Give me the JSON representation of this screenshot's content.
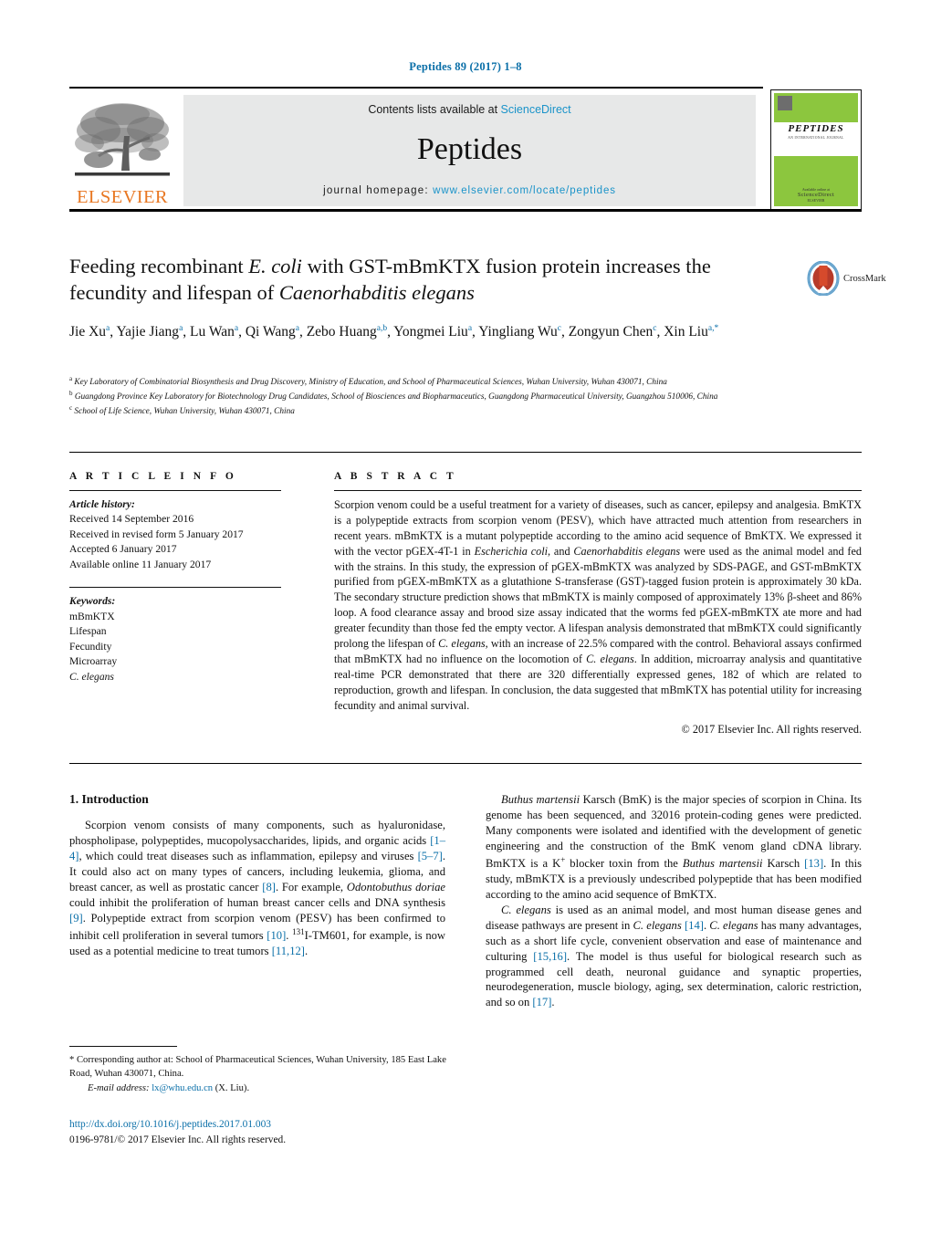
{
  "running_head": "Peptides 89 (2017) 1–8",
  "masthead": {
    "contents_prefix": "Contents lists available at ",
    "contents_link": "ScienceDirect",
    "journal_name": "Peptides",
    "homepage_prefix": "journal homepage: ",
    "homepage_url": "www.elsevier.com/locate/peptides",
    "publisher_logo_text": "ELSEVIER",
    "cover": {
      "title": "PEPTIDES",
      "subtitle": "AN INTERNATIONAL JOURNAL",
      "publisher": "ELSEVIER",
      "available_at": "Available online at",
      "science_direct": "ScienceDirect"
    }
  },
  "article": {
    "title_line1_a": "Feeding recombinant ",
    "title_line1_i": "E. coli",
    "title_line1_b": " with GST-mBmKTX fusion protein",
    "title_line2_a": "increases the fecundity and lifespan of ",
    "title_line2_i": "Caenorhabditis elegans",
    "crossmark_label": "CrossMark",
    "authors": [
      {
        "name": "Jie Xu",
        "sup": "a"
      },
      {
        "name": "Yajie Jiang",
        "sup": "a"
      },
      {
        "name": "Lu Wan",
        "sup": "a"
      },
      {
        "name": "Qi Wang",
        "sup": "a"
      },
      {
        "name": "Zebo Huang",
        "sup": "a,b"
      },
      {
        "name": "Yongmei Liu",
        "sup": "a"
      },
      {
        "name": "Yingliang Wu",
        "sup": "c"
      },
      {
        "name": "Zongyun Chen",
        "sup": "c"
      },
      {
        "name": "Xin Liu",
        "sup": "a,*"
      }
    ],
    "affiliations": [
      {
        "marker": "a",
        "text": "Key Laboratory of Combinatorial Biosynthesis and Drug Discovery, Ministry of Education, and School of Pharmaceutical Sciences, Wuhan University, Wuhan 430071, China"
      },
      {
        "marker": "b",
        "text": "Guangdong Province Key Laboratory for Biotechnology Drug Candidates, School of Biosciences and Biopharmaceutics, Guangdong Pharmaceutical University, Guangzhou 510006, China"
      },
      {
        "marker": "c",
        "text": "School of Life Science, Wuhan University, Wuhan 430071, China"
      }
    ]
  },
  "article_info": {
    "heading": "A R T I C L E   I N F O",
    "history_label": "Article history:",
    "history": [
      "Received 14 September 2016",
      "Received in revised form 5 January 2017",
      "Accepted 6 January 2017",
      "Available online 11 January 2017"
    ],
    "keywords_label": "Keywords:",
    "keywords": [
      "mBmKTX",
      "Lifespan",
      "Fecundity",
      "Microarray",
      "C. elegans"
    ]
  },
  "abstract": {
    "heading": "A B S T R A C T",
    "text_parts": [
      {
        "t": "Scorpion venom could be a useful treatment for a variety of diseases, such as cancer, epilepsy and analgesia. BmKTX is a polypeptide extracts from scorpion venom (PESV), which have attracted much attention from researchers in recent years. mBmKTX is a mutant polypeptide according to the amino acid sequence of BmKTX. We expressed it with the vector pGEX-4T-1 in ",
        "i": false
      },
      {
        "t": "Escherichia coli",
        "i": true
      },
      {
        "t": ", and ",
        "i": false
      },
      {
        "t": "Caenorhabditis elegans",
        "i": true
      },
      {
        "t": " were used as the animal model and fed with the strains. In this study, the expression of pGEX-mBmKTX was analyzed by SDS-PAGE, and GST-mBmKTX purified from pGEX-mBmKTX as a glutathione S-transferase (GST)-tagged fusion protein is approximately 30 kDa. The secondary structure prediction shows that mBmKTX is mainly composed of approximately 13% β-sheet and 86% loop. A food clearance assay and brood size assay indicated that the worms fed pGEX-mBmKTX ate more and had greater fecundity than those fed the empty vector. A lifespan analysis demonstrated that mBmKTX could significantly prolong the lifespan of ",
        "i": false
      },
      {
        "t": "C. elegans",
        "i": true
      },
      {
        "t": ", with an increase of 22.5% compared with the control. Behavioral assays confirmed that mBmKTX had no influence on the locomotion of ",
        "i": false
      },
      {
        "t": "C. elegans",
        "i": true
      },
      {
        "t": ". In addition, microarray analysis and quantitative real-time PCR demonstrated that there are 320 differentially expressed genes, 182 of which are related to reproduction, growth and lifespan. In conclusion, the data suggested that mBmKTX has potential utility for increasing fecundity and animal survival.",
        "i": false
      }
    ],
    "copyright": "© 2017 Elsevier Inc. All rights reserved."
  },
  "introduction": {
    "heading": "1. Introduction",
    "left_paragraph": [
      {
        "t": "Scorpion venom consists of many components, such as hyaluronidase, phospholipase, polypeptides, mucopolysaccharides, lipids, and organic acids ",
        "k": "n"
      },
      {
        "t": "[1–4]",
        "k": "ref"
      },
      {
        "t": ", which could treat diseases such as inflammation, epilepsy and viruses ",
        "k": "n"
      },
      {
        "t": "[5–7]",
        "k": "ref"
      },
      {
        "t": ". It could also act on many types of cancers, including leukemia, glioma, and breast cancer, as well as prostatic cancer ",
        "k": "n"
      },
      {
        "t": "[8]",
        "k": "ref"
      },
      {
        "t": ". For example, ",
        "k": "n"
      },
      {
        "t": "Odontobuthus doriae",
        "k": "i"
      },
      {
        "t": " could inhibit the proliferation of human breast cancer cells and DNA synthesis ",
        "k": "n"
      },
      {
        "t": "[9]",
        "k": "ref"
      },
      {
        "t": ". Polypeptide extract from scorpion venom (PESV) has been confirmed to inhibit cell proliferation in several tumors ",
        "k": "n"
      },
      {
        "t": "[10]",
        "k": "ref"
      },
      {
        "t": ". ",
        "k": "n"
      },
      {
        "t": "131",
        "k": "sup"
      },
      {
        "t": "I-TM601, for example, is now used as a potential medicine to treat tumors ",
        "k": "n"
      },
      {
        "t": "[11,12]",
        "k": "ref"
      },
      {
        "t": ".",
        "k": "n"
      }
    ],
    "right_paragraph_1": [
      {
        "t": "Buthus martensii",
        "k": "i"
      },
      {
        "t": " Karsch (BmK) is the major species of scorpion in China. Its genome has been sequenced, and 32016 protein-coding genes were predicted. Many components were isolated and identified with the development of genetic engineering and the construction of the BmK venom gland cDNA library. BmKTX is a K",
        "k": "n"
      },
      {
        "t": "+",
        "k": "sup"
      },
      {
        "t": " blocker toxin from the ",
        "k": "n"
      },
      {
        "t": "Buthus martensii",
        "k": "i"
      },
      {
        "t": " Karsch ",
        "k": "n"
      },
      {
        "t": "[13]",
        "k": "ref"
      },
      {
        "t": ". In this study, mBmKTX is a previously undescribed polypeptide that has been modified according to the amino acid sequence of BmKTX.",
        "k": "n"
      }
    ],
    "right_paragraph_2": [
      {
        "t": "C. elegans",
        "k": "i"
      },
      {
        "t": " is used as an animal model, and most human disease genes and disease pathways are present in ",
        "k": "n"
      },
      {
        "t": "C. elegans",
        "k": "i"
      },
      {
        "t": " ",
        "k": "n"
      },
      {
        "t": "[14]",
        "k": "ref"
      },
      {
        "t": ". ",
        "k": "n"
      },
      {
        "t": "C. elegans",
        "k": "i"
      },
      {
        "t": " has many advantages, such as a short life cycle, convenient observation and ease of maintenance and culturing ",
        "k": "n"
      },
      {
        "t": "[15,16]",
        "k": "ref"
      },
      {
        "t": ". The model is thus useful for biological research such as programmed cell death, neuronal guidance and synaptic properties, neurodegeneration, muscle biology, aging, sex determination, caloric restriction, and so on ",
        "k": "n"
      },
      {
        "t": "[17]",
        "k": "ref"
      },
      {
        "t": ".",
        "k": "n"
      }
    ]
  },
  "footer": {
    "corresponding_marker": "*",
    "corresponding_text": "Corresponding author at: School of Pharmaceutical Sciences, Wuhan University, 185 East Lake Road, Wuhan 430071, China.",
    "email_label": "E-mail address:",
    "email": "lx@whu.edu.cn",
    "email_owner": "(X. Liu).",
    "doi": "http://dx.doi.org/10.1016/j.peptides.2017.01.003",
    "issn_line": "0196-9781/© 2017 Elsevier Inc. All rights reserved."
  }
}
